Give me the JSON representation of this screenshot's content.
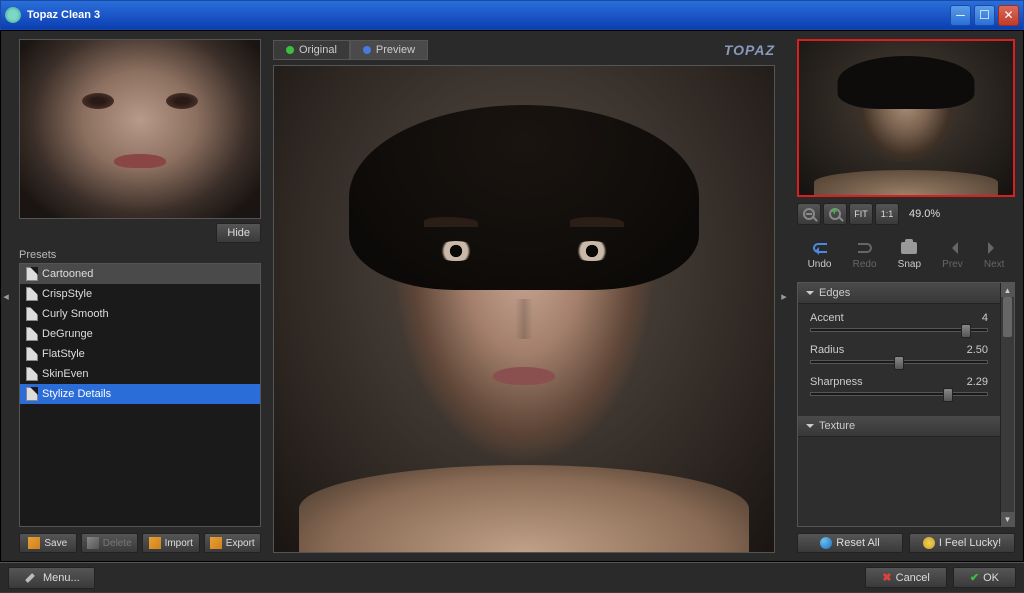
{
  "window": {
    "title": "Topaz Clean 3"
  },
  "leftPanel": {
    "hideBtn": "Hide",
    "presetsLabel": "Presets",
    "presets": [
      {
        "name": "Cartooned"
      },
      {
        "name": "CrispStyle"
      },
      {
        "name": "Curly Smooth"
      },
      {
        "name": "DeGrunge"
      },
      {
        "name": "FlatStyle"
      },
      {
        "name": "SkinEven"
      },
      {
        "name": "Stylize Details"
      }
    ],
    "buttons": {
      "save": "Save",
      "delete": "Delete",
      "import": "Import",
      "export": "Export"
    }
  },
  "center": {
    "tabs": {
      "original": "Original",
      "preview": "Preview"
    },
    "logo": "TOPAZ"
  },
  "rightPanel": {
    "zoom": {
      "fit": "FIT",
      "oneToOne": "1:1",
      "percent": "49.0%"
    },
    "actions": {
      "undo": "Undo",
      "redo": "Redo",
      "snap": "Snap",
      "prev": "Prev",
      "next": "Next"
    },
    "sections": {
      "edges": {
        "title": "Edges",
        "sliders": [
          {
            "label": "Accent",
            "value": "4",
            "pos": 88
          },
          {
            "label": "Radius",
            "value": "2.50",
            "pos": 50
          },
          {
            "label": "Sharpness",
            "value": "2.29",
            "pos": 78
          }
        ]
      },
      "texture": {
        "title": "Texture"
      }
    },
    "bottom": {
      "reset": "Reset All",
      "lucky": "I Feel Lucky!"
    }
  },
  "footer": {
    "menu": "Menu...",
    "cancel": "Cancel",
    "ok": "OK"
  }
}
